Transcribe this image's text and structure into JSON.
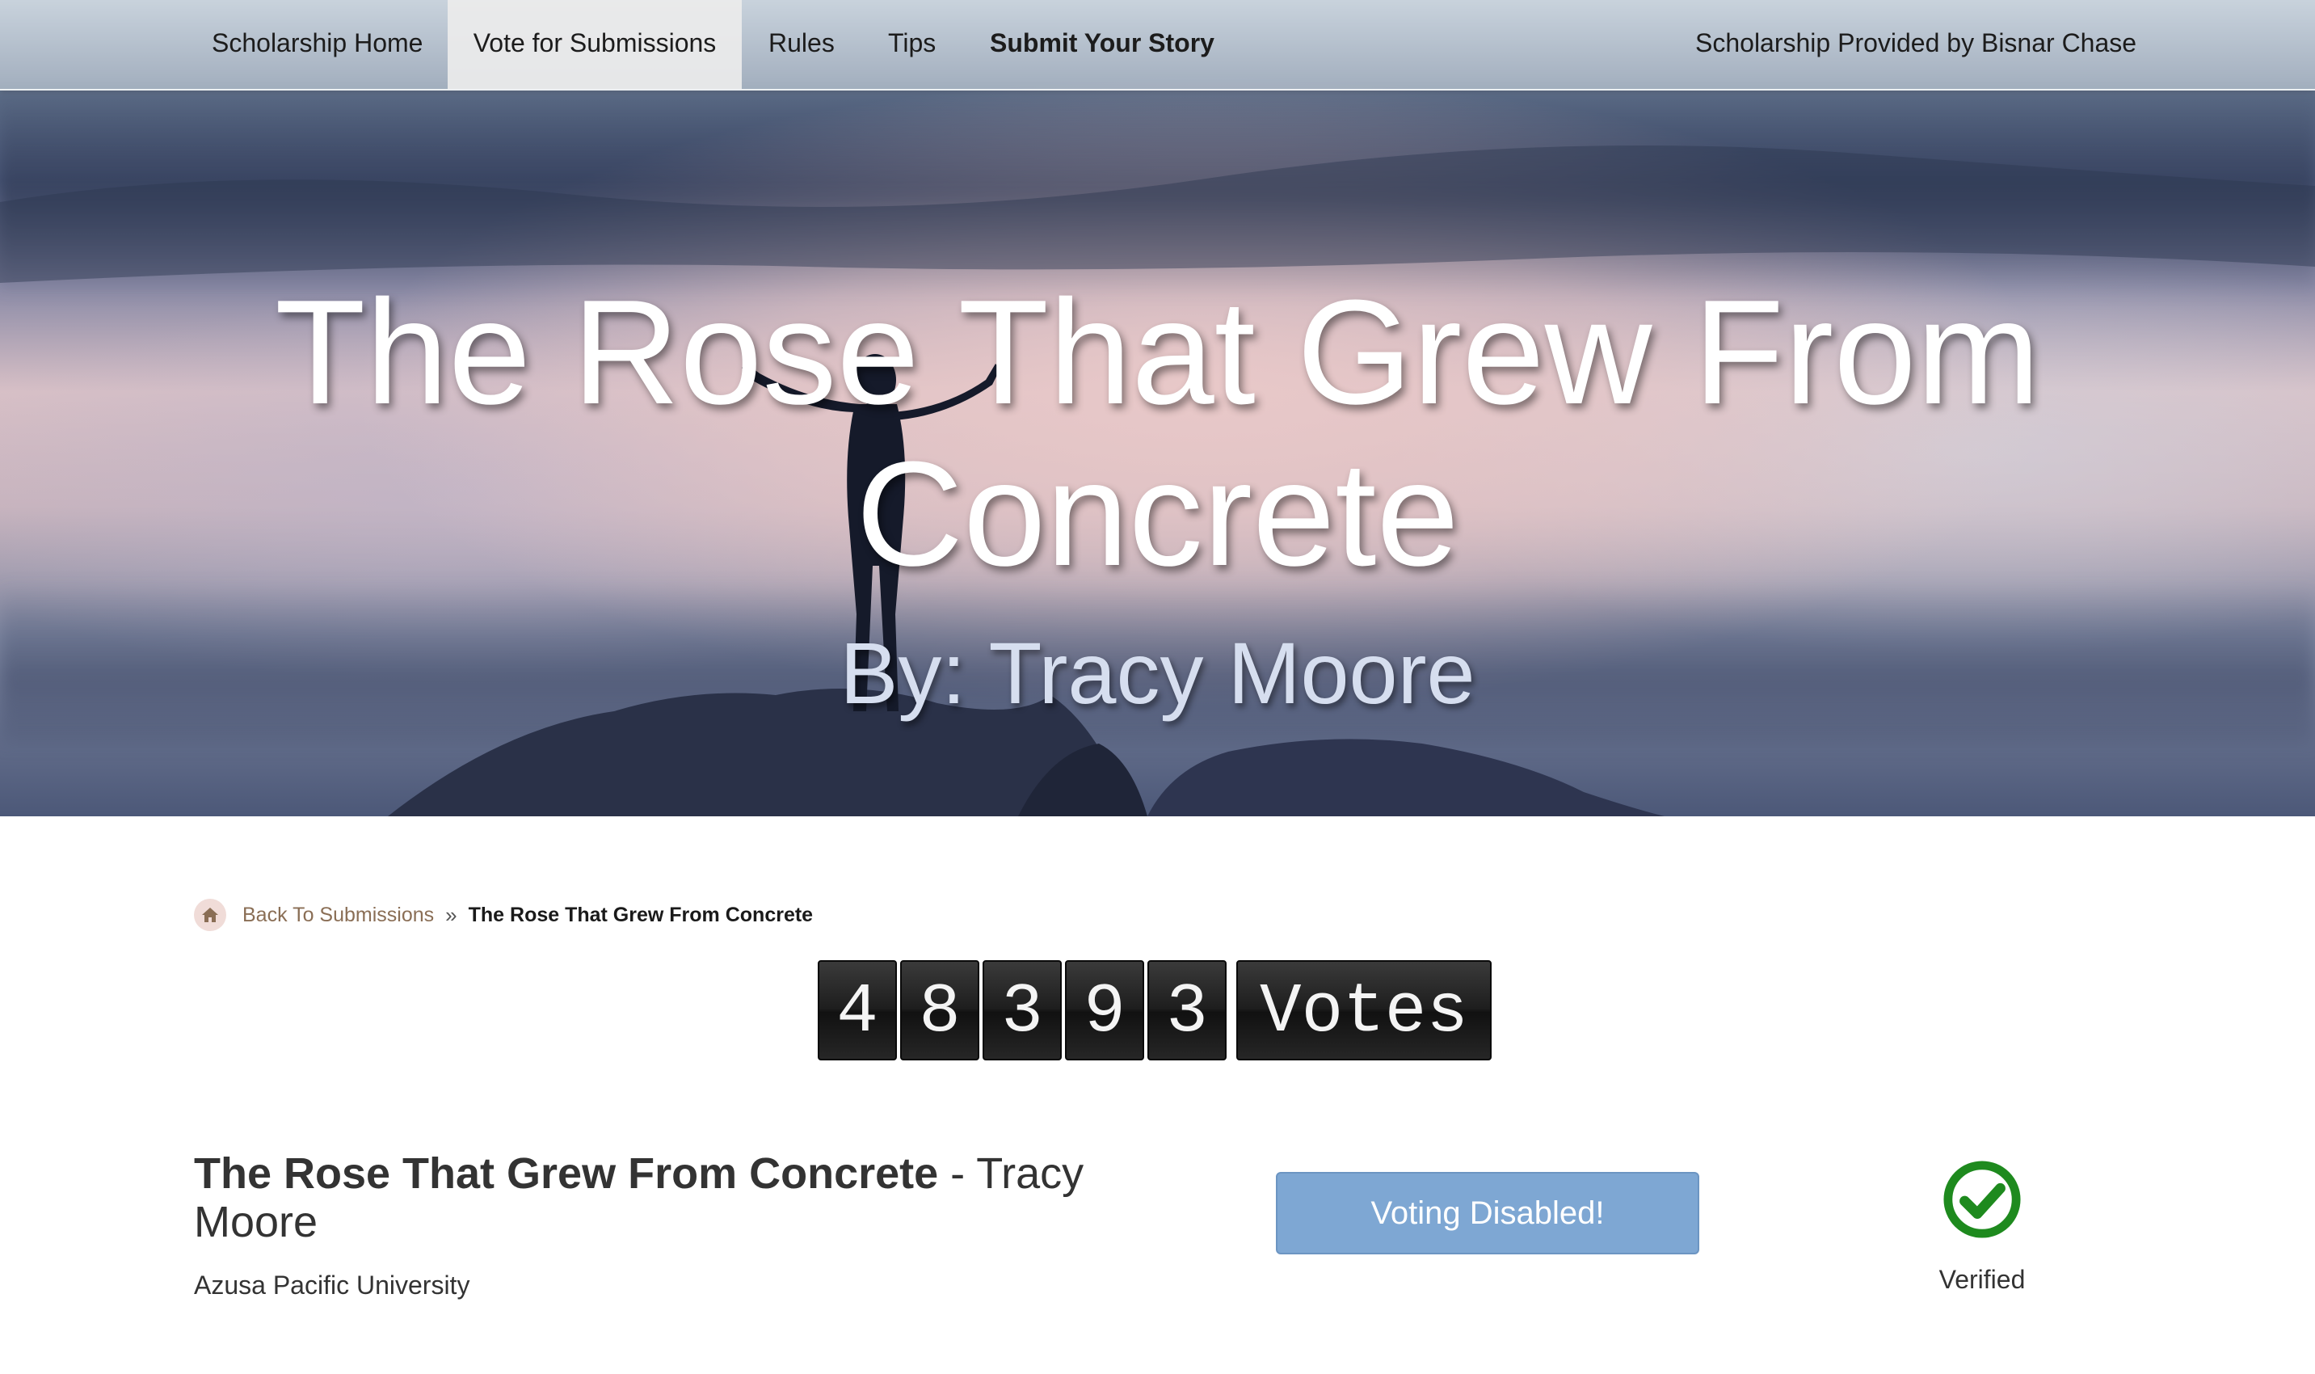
{
  "nav": {
    "items": [
      {
        "label": "Scholarship Home"
      },
      {
        "label": "Vote for Submissions"
      },
      {
        "label": "Rules"
      },
      {
        "label": "Tips"
      },
      {
        "label": "Submit Your Story"
      }
    ],
    "sponsor": "Scholarship Provided by Bisnar Chase"
  },
  "hero": {
    "title": "The Rose That Grew From Concrete",
    "author": "By: Tracy Moore"
  },
  "breadcrumb": {
    "home_icon": "home-icon",
    "back_label": "Back To Submissions",
    "separator": "»",
    "current": "The Rose That Grew From Concrete"
  },
  "votes": {
    "digits": [
      "4",
      "8",
      "3",
      "9",
      "3"
    ],
    "label": "Votes",
    "count": 48393
  },
  "submission": {
    "title": "The Rose That Grew From Concrete",
    "separator": " - ",
    "author": "Tracy Moore",
    "school": "Azusa Pacific University",
    "vote_button": "Voting Disabled!",
    "verified_label": "Verified",
    "verified_icon": "check-circle-icon"
  },
  "colors": {
    "vote_button": "#7ea7d3",
    "verified": "#1e8a1e",
    "breadcrumb_link": "#8a6e55"
  }
}
